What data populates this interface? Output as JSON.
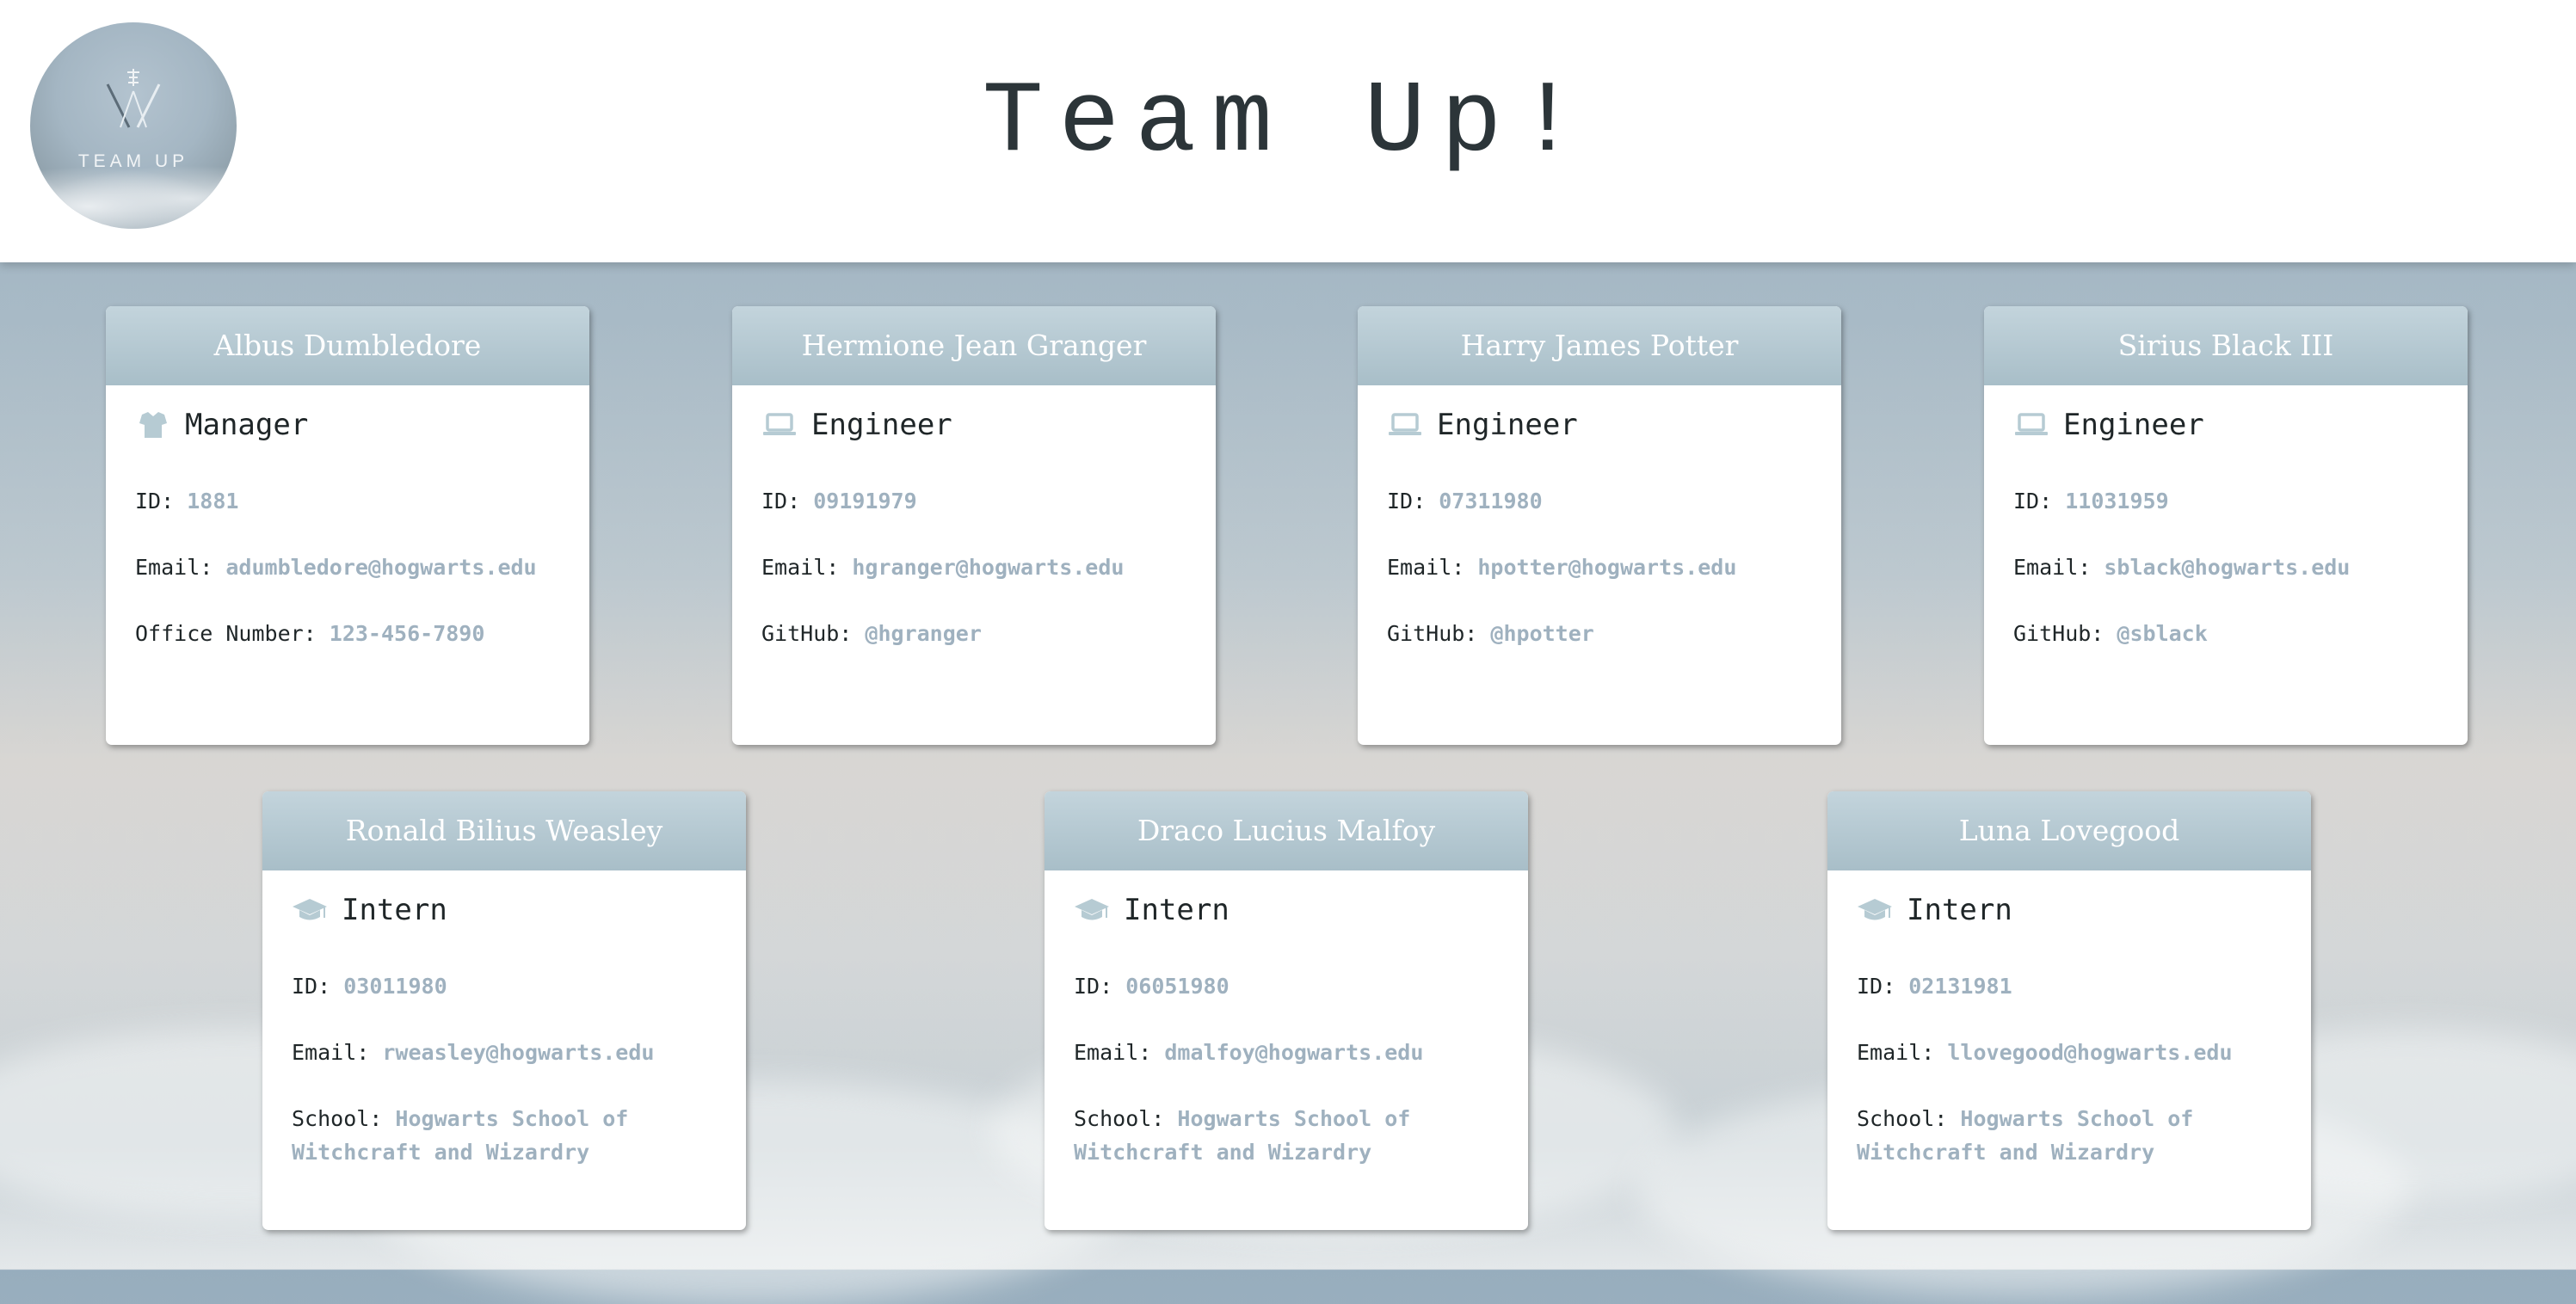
{
  "header": {
    "title": "Team Up!",
    "logo_text": "TEAM UP"
  },
  "colors": {
    "card_header": "#b2c6cf",
    "value_text": "#9fb1bf",
    "role_icon": "#b6cbd3"
  },
  "labels": {
    "id": "ID:",
    "email": "Email:",
    "office": "Office Number:",
    "github": "GitHub:",
    "school": "School:"
  },
  "cards": [
    {
      "name": "Albus Dumbledore",
      "role": "Manager",
      "icon": "manager-icon",
      "id": "1881",
      "email": "adumbledore@hogwarts.edu",
      "extra": "123-456-7890"
    },
    {
      "name": "Hermione Jean Granger",
      "role": "Engineer",
      "icon": "laptop-icon",
      "id": "09191979",
      "email": "hgranger@hogwarts.edu",
      "extra": "@hgranger"
    },
    {
      "name": "Harry James Potter",
      "role": "Engineer",
      "icon": "laptop-icon",
      "id": "07311980",
      "email": "hpotter@hogwarts.edu",
      "extra": "@hpotter"
    },
    {
      "name": "Sirius Black III",
      "role": "Engineer",
      "icon": "laptop-icon",
      "id": "11031959",
      "email": "sblack@hogwarts.edu",
      "extra": "@sblack"
    },
    {
      "name": "Ronald Bilius Weasley",
      "role": "Intern",
      "icon": "graduation-cap-icon",
      "id": "03011980",
      "email": "rweasley@hogwarts.edu",
      "extra": "Hogwarts School of Witchcraft and Wizardry"
    },
    {
      "name": "Draco Lucius Malfoy",
      "role": "Intern",
      "icon": "graduation-cap-icon",
      "id": "06051980",
      "email": "dmalfoy@hogwarts.edu",
      "extra": "Hogwarts School of Witchcraft and Wizardry"
    },
    {
      "name": "Luna Lovegood",
      "role": "Intern",
      "icon": "graduation-cap-icon",
      "id": "02131981",
      "email": "llovegood@hogwarts.edu",
      "extra": "Hogwarts School of Witchcraft and Wizardry"
    }
  ]
}
